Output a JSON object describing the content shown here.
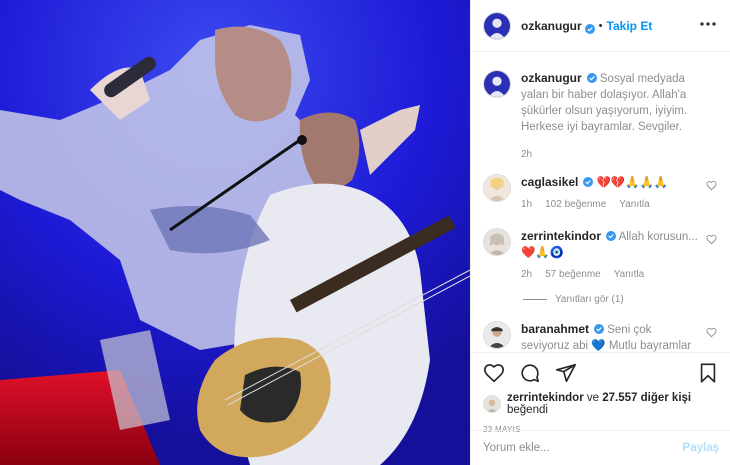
{
  "header": {
    "username": "ozkanugur",
    "separator": "•",
    "follow_label": "Takip Et"
  },
  "caption": {
    "username": "ozkanugur",
    "text": "Sosyal medyada yalan bir haber dolaşıyor. Allah'a şükürler olsun yaşıyorum, iyiyim. Herkese iyi bayramlar. Sevgiler.",
    "time": "2h"
  },
  "comments": [
    {
      "username": "caglasikel",
      "text": "💔💔🙏🙏🙏",
      "time": "1h",
      "likes": "102 beğenme",
      "reply": "Yanıtla"
    },
    {
      "username": "zerrintekindor",
      "text": "Allah korusun...",
      "text2": "❤️🙏🧿",
      "time": "2h",
      "likes": "57 beğenme",
      "reply": "Yanıtla",
      "view_replies": "Yanıtları gör (1)"
    },
    {
      "username": "baranahmet",
      "text": "Seni çok seviyoruz abi 💙 Mutlu bayramlar 🌈🙏❤️"
    }
  ],
  "likes": {
    "user": "zerrintekindor",
    "conjunction": "ve",
    "others": "27.557 diğer kişi",
    "suffix": "beğendi"
  },
  "date": "23 MAYIS",
  "comment_box": {
    "placeholder": "Yorum ekle...",
    "post_label": "Paylaş"
  },
  "colors": {
    "accent": "#0095f6",
    "photo_blue": "#1d1ad6",
    "verified": "#3897f0",
    "post_disabled": "#b2dffc"
  },
  "icons": [
    "more-icon",
    "verified-icon",
    "heart-icon",
    "comment-icon",
    "share-icon",
    "bookmark-icon"
  ]
}
